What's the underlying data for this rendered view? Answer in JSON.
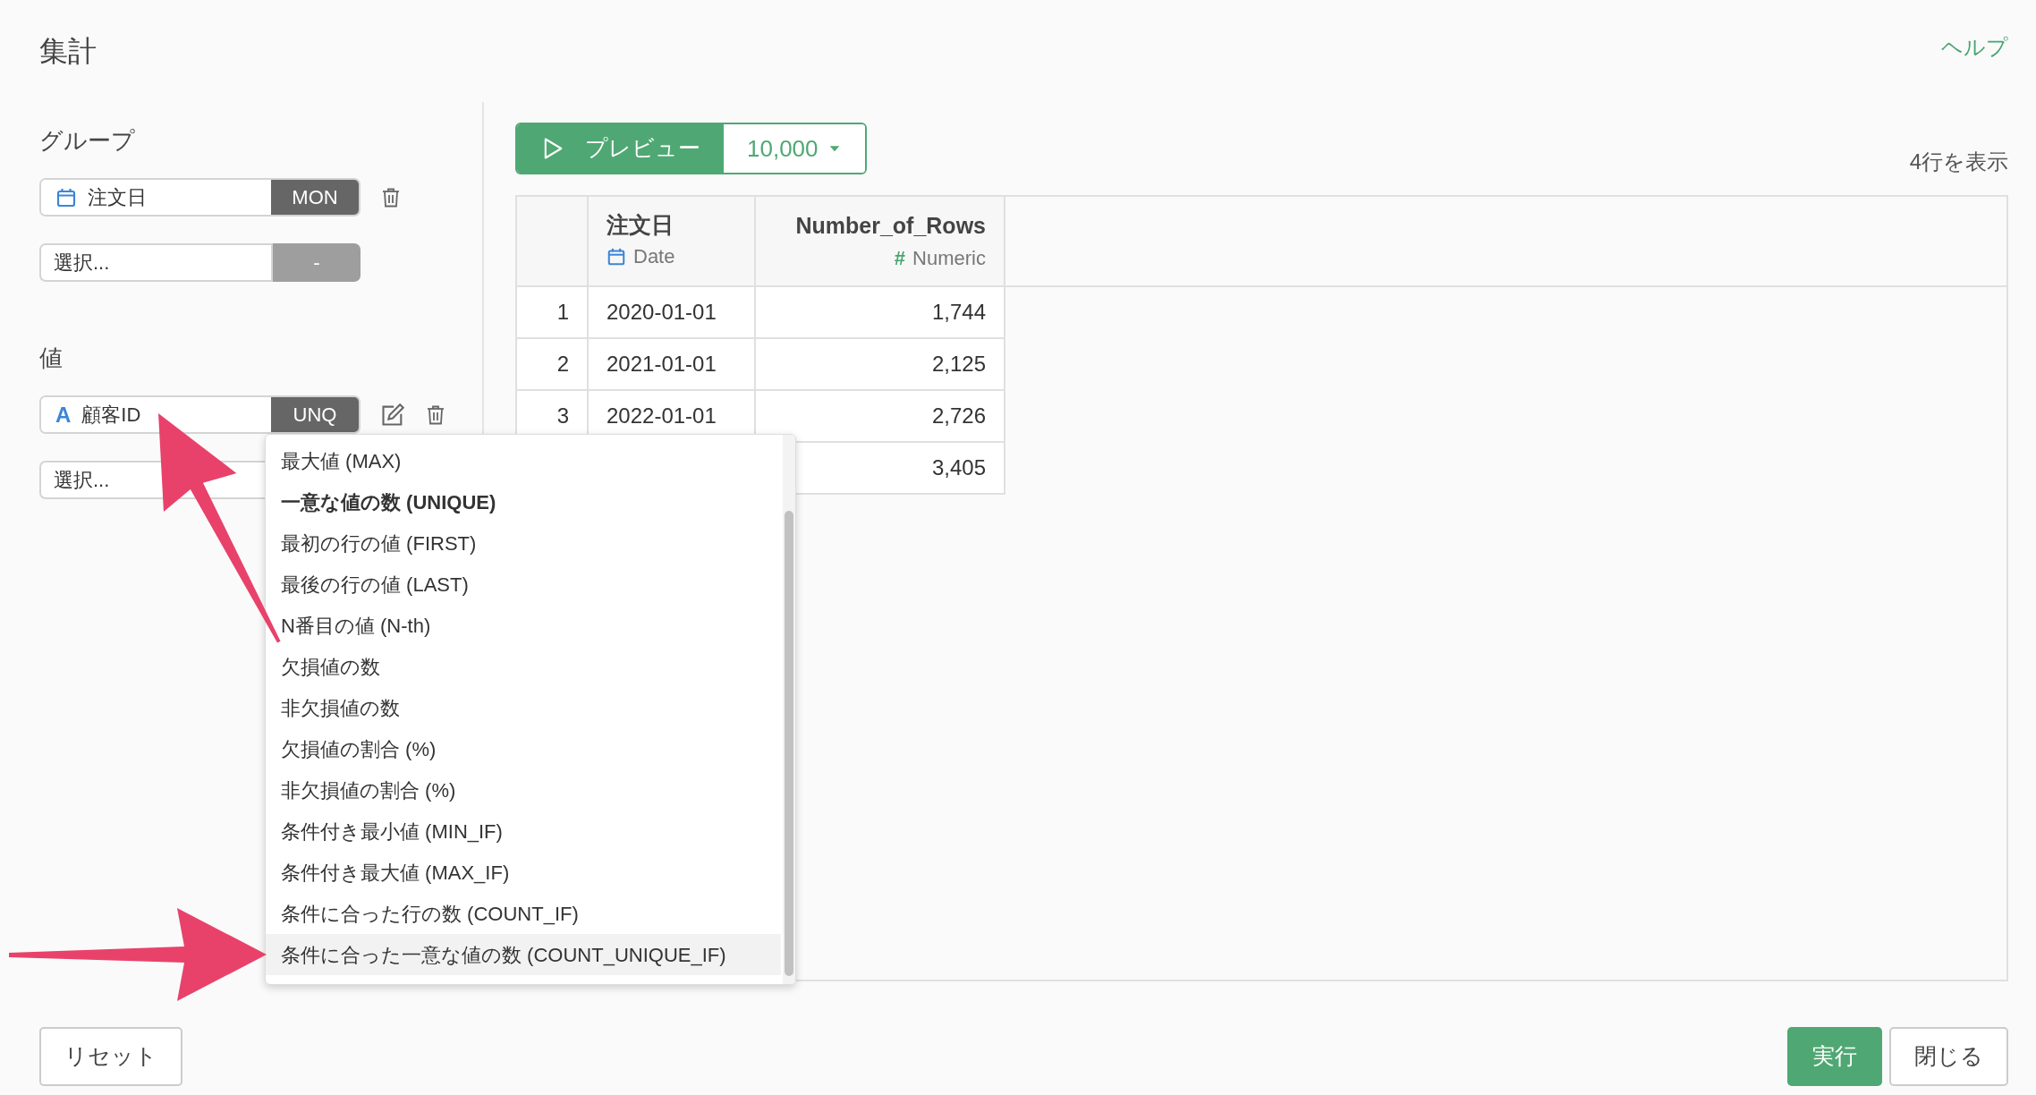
{
  "title": "集計",
  "help_link": "ヘルプ",
  "group_section": {
    "label": "グループ",
    "fields": [
      {
        "kind": "date",
        "value": "注文日",
        "badge": "MON",
        "badge_active": true,
        "deletable": true,
        "editable": false
      },
      {
        "kind": "empty",
        "placeholder": "選択...",
        "badge": "-",
        "badge_active": false,
        "deletable": false,
        "editable": false
      }
    ]
  },
  "value_section": {
    "label": "値",
    "fields": [
      {
        "kind": "text",
        "glyph": "A",
        "value": "顧客ID",
        "badge": "UNQ",
        "badge_active": true,
        "deletable": true,
        "editable": true
      },
      {
        "kind": "empty",
        "placeholder": "選択..."
      }
    ]
  },
  "preview": {
    "button": "プレビュー",
    "row_limit": "10,000",
    "row_count": "4行を表示"
  },
  "table": {
    "columns": [
      {
        "name": "注文日",
        "type": "Date",
        "kind": "date"
      },
      {
        "name": "Number_of_Rows",
        "type": "Numeric",
        "kind": "numeric",
        "glyph": "#"
      }
    ],
    "rows": [
      {
        "index": "1",
        "cells": [
          "2020-01-01",
          "1,744"
        ]
      },
      {
        "index": "2",
        "cells": [
          "2021-01-01",
          "2,125"
        ]
      },
      {
        "index": "3",
        "cells": [
          "2022-01-01",
          "2,726"
        ]
      },
      {
        "index": null,
        "cells": [
          null,
          "3,405"
        ]
      }
    ]
  },
  "dropdown": {
    "items": [
      {
        "label": "最大値 (MAX)",
        "selected": false,
        "highlighted": false
      },
      {
        "label": "一意な値の数 (UNIQUE)",
        "selected": true,
        "highlighted": false
      },
      {
        "label": "最初の行の値 (FIRST)",
        "selected": false,
        "highlighted": false
      },
      {
        "label": "最後の行の値 (LAST)",
        "selected": false,
        "highlighted": false
      },
      {
        "label": "N番目の値 (N-th)",
        "selected": false,
        "highlighted": false
      },
      {
        "label": "欠損値の数",
        "selected": false,
        "highlighted": false
      },
      {
        "label": "非欠損値の数",
        "selected": false,
        "highlighted": false
      },
      {
        "label": "欠損値の割合 (%)",
        "selected": false,
        "highlighted": false
      },
      {
        "label": "非欠損値の割合 (%)",
        "selected": false,
        "highlighted": false
      },
      {
        "label": "条件付き最小値 (MIN_IF)",
        "selected": false,
        "highlighted": false
      },
      {
        "label": "条件付き最大値 (MAX_IF)",
        "selected": false,
        "highlighted": false
      },
      {
        "label": "条件に合った行の数 (COUNT_IF)",
        "selected": false,
        "highlighted": false
      },
      {
        "label": "条件に合った一意な値の数 (COUNT_UNIQUE_IF)",
        "selected": false,
        "highlighted": true
      }
    ]
  },
  "buttons": {
    "reset": "リセット",
    "run": "実行",
    "close": "閉じる"
  }
}
